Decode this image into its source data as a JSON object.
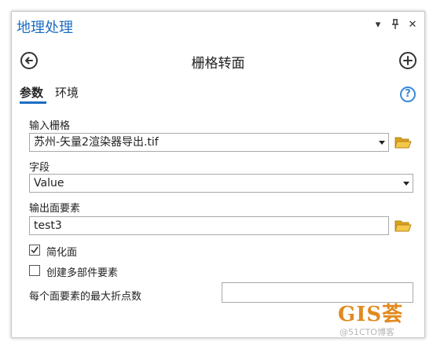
{
  "pane": {
    "title": "地理处理",
    "controls": {
      "menu_icon": "chevron-down-icon",
      "pin_icon": "pin-icon",
      "close_icon": "close-icon",
      "menu_glyph": "▾",
      "pin_glyph": "ᛘ",
      "close_glyph": "✕"
    }
  },
  "tool": {
    "title": "栅格转面",
    "back_icon": "back-arrow-icon",
    "add_icon": "add-icon"
  },
  "tabs": [
    {
      "label": "参数",
      "active": true
    },
    {
      "label": "环境",
      "active": false
    }
  ],
  "help_icon": {
    "name": "help-icon",
    "glyph": "?"
  },
  "params": {
    "input_raster": {
      "label": "输入栅格",
      "value": "苏州-矢量2渲染器导出.tif"
    },
    "field": {
      "label": "字段",
      "value": "Value"
    },
    "output": {
      "label": "输出面要素",
      "value": "test3"
    },
    "simplify": {
      "label": "简化面",
      "checked": true
    },
    "multipart": {
      "label": "创建多部件要素",
      "checked": false
    },
    "max_vertices": {
      "label": "每个面要素的最大折点数",
      "value": ""
    }
  },
  "watermark": {
    "brand": "GIS荟",
    "site": "@51CTO博客"
  },
  "colors": {
    "accent": "#1d6ec2",
    "folder": "#e6b32e",
    "help": "#3a8ad8",
    "watermark": "#e08a1e"
  }
}
